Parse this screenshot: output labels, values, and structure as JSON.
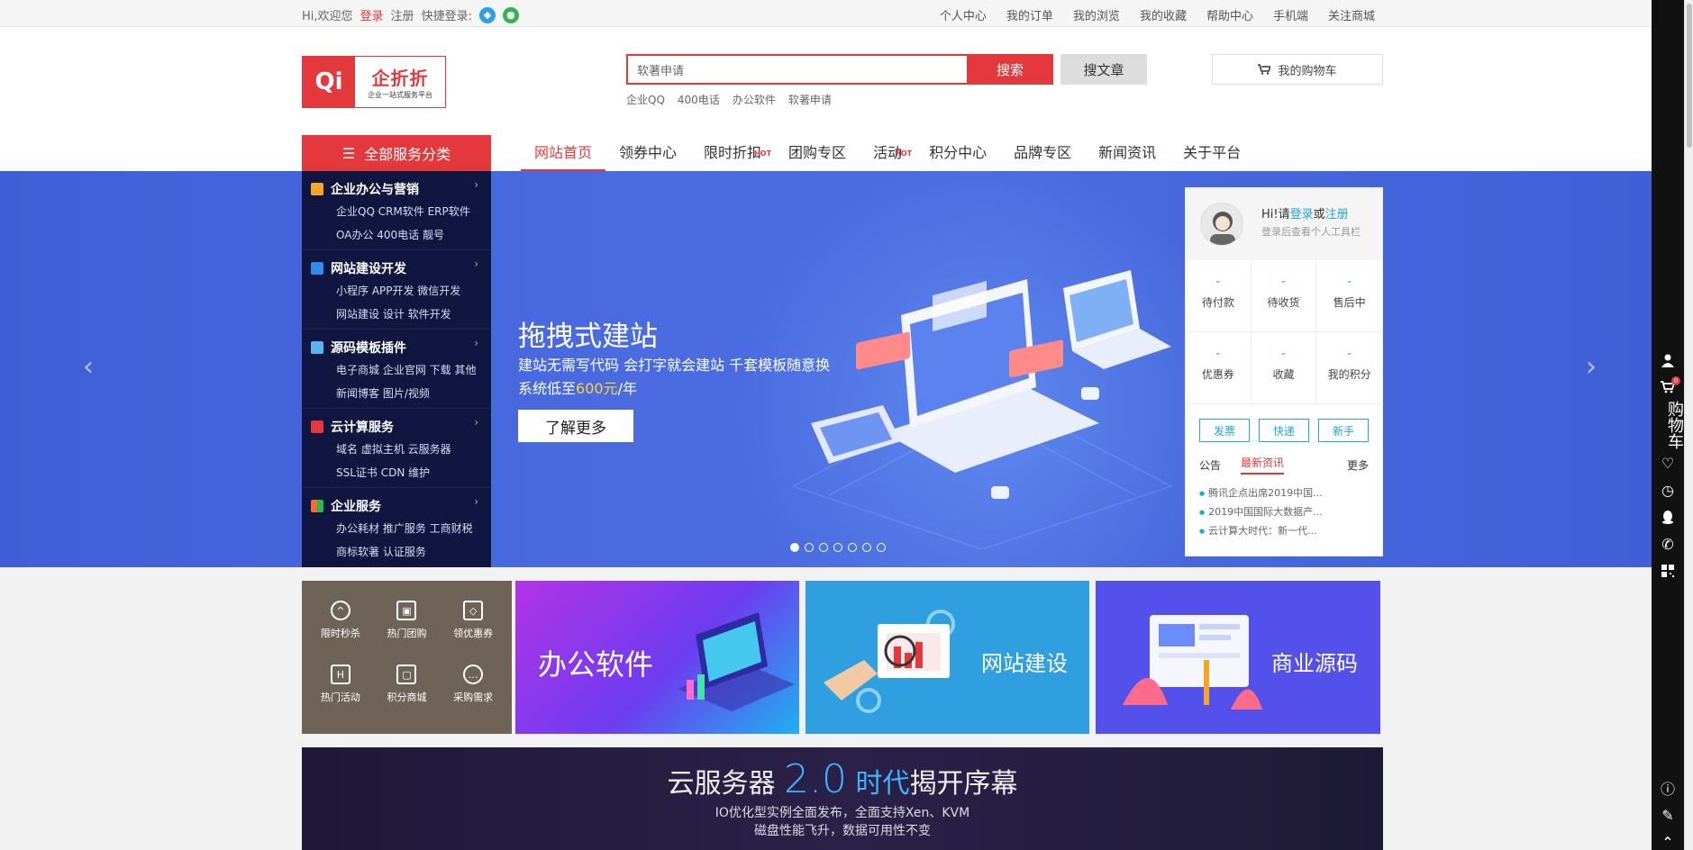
{
  "topbar": {
    "greeting": "Hi,欢迎您",
    "login": "登录",
    "register": "注册",
    "quick_login": "快捷登录:",
    "links": [
      "个人中心",
      "我的订单",
      "我的浏览",
      "我的收藏",
      "帮助中心",
      "手机端",
      "关注商城"
    ]
  },
  "logo": {
    "mark": "Qi",
    "name": "企折折",
    "tagline": "企业一站式服务平台"
  },
  "search": {
    "placeholder": "软著申请",
    "button": "搜索",
    "button_article": "搜文章",
    "hot": [
      "企业QQ",
      "400电话",
      "办公软件",
      "软著申请"
    ]
  },
  "cart": {
    "label": "我的购物车"
  },
  "nav": {
    "all_categories": "全部服务分类",
    "items": [
      "网站首页",
      "领券中心",
      "限时折扣",
      "团购专区",
      "活动",
      "积分中心",
      "品牌专区",
      "新闻资讯",
      "关于平台"
    ],
    "hot_tag": "HOT"
  },
  "categories": [
    {
      "title": "企业办公与营销",
      "lines": [
        "企业QQ  CRM软件  ERP软件",
        "OA办公  400电话  靓号"
      ],
      "color": "#f5a623"
    },
    {
      "title": "网站建设开发",
      "lines": [
        "小程序  APP开发  微信开发",
        "网站建设  设计  软件开发"
      ],
      "color": "#2e8bf0"
    },
    {
      "title": "源码模板插件",
      "lines": [
        "电子商城  企业官网  下载  其他",
        "新闻博客  图片/视频"
      ],
      "color": "#5ab4f0"
    },
    {
      "title": "云计算服务",
      "lines": [
        "域名  虚拟主机  云服务器",
        "SSL证书  CDN  维护"
      ],
      "color": "#e4393c"
    },
    {
      "title": "企业服务",
      "lines": [
        "办公耗材  推广服务  工商财税",
        "商标软著  认证服务"
      ],
      "color": "#f06e2e"
    }
  ],
  "banner": {
    "title": "拖拽式建站",
    "line1": "建站无需写代码 会打字就会建站 千套模板随意换",
    "line2_prefix": "系统低至",
    "line2_price": "600元",
    "line2_suffix": "/年",
    "button": "了解更多",
    "slides": 7,
    "active_slide": 1
  },
  "user_panel": {
    "hi": "Hi!请",
    "login": "登录",
    "or": "或",
    "register": "注册",
    "tip": "登录后查看个人工具栏",
    "stats": [
      {
        "value": "-",
        "label": "待付款"
      },
      {
        "value": "-",
        "label": "待收货"
      },
      {
        "value": "-",
        "label": "售后中"
      },
      {
        "value": "-",
        "label": "优惠券"
      },
      {
        "value": "-",
        "label": "收藏"
      },
      {
        "value": "-",
        "label": "我的积分"
      }
    ],
    "buttons": [
      "发票",
      "快递",
      "新手"
    ],
    "tabs": [
      "公告",
      "最新资讯"
    ],
    "more": "更多",
    "news": [
      "腾讯企点出席2019中国...",
      "2019中国国际大数据产...",
      "云计算大时代：新一代..."
    ]
  },
  "quick": [
    "限时秒杀",
    "热门团购",
    "领优惠券",
    "热门活动",
    "积分商城",
    "采购需求"
  ],
  "tiles": [
    "办公软件",
    "网站建设",
    "商业源码"
  ],
  "cloud": {
    "prefix": "云服务器",
    "version": "2.0",
    "era": "时代",
    "suffix": "揭开序幕",
    "line1": "IO优化型实例全面发布，全面支持Xen、KVM",
    "line2": "磁盘性能飞升，数据可用性不变"
  },
  "sidebar": {
    "cart": "购物车",
    "cart_count": "0"
  },
  "colors": {
    "brand": "#e4393c",
    "link_blue": "#1fa7d8",
    "banner": "#4a6ce0",
    "menu": "#10143c"
  }
}
